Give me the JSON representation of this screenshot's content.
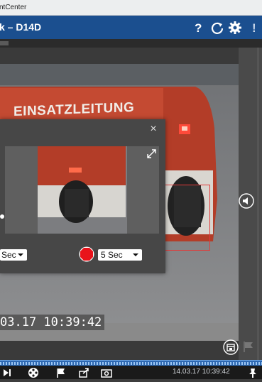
{
  "window": {
    "title": "ntCenter"
  },
  "header": {
    "title": "k – D14D"
  },
  "video": {
    "vehicle_text": "EINSATZLEITUNG",
    "timestamp": "03.17 10:39:42"
  },
  "popup": {
    "left_select": "Sec",
    "right_select": "5 Sec"
  },
  "bottom": {
    "datetime": "14.03.17 10:39:42"
  },
  "colors": {
    "header_bg": "#1b4f8f",
    "timeline": "#2d68b2",
    "stop_red": "#e8131b",
    "roi_box": "#e23a3a"
  }
}
